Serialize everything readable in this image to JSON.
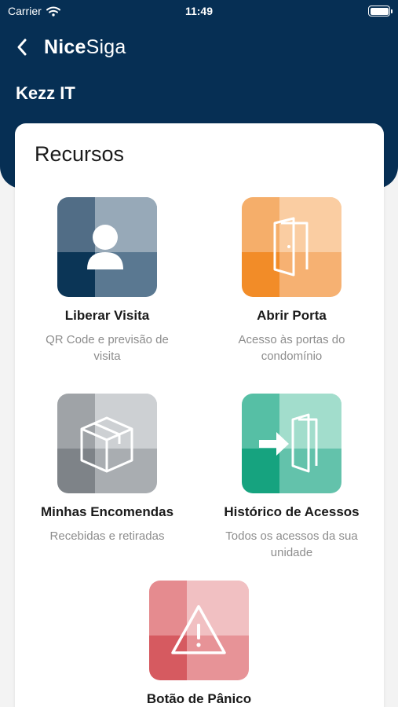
{
  "status_bar": {
    "carrier": "Carrier",
    "time": "11:49",
    "battery_level": 1.0
  },
  "nav": {
    "brand_bold": "Nice",
    "brand_regular": "Siga"
  },
  "company": "Kezz IT",
  "section_title": "Recursos",
  "features": [
    {
      "label": "Liberar Visita",
      "desc": "QR Code e previsão de visita",
      "icon": "user-icon",
      "colors": [
        "#516d86",
        "#97a9b8",
        "#0b3556",
        "#5a7891"
      ]
    },
    {
      "label": "Abrir Porta",
      "desc": "Acesso às portas do condomínio",
      "icon": "door-icon",
      "colors": [
        "#f5ae6a",
        "#facda2",
        "#f28c28",
        "#f6b172"
      ]
    },
    {
      "label": "Minhas Encomendas",
      "desc": "Recebidas e retiradas",
      "icon": "box-icon",
      "colors": [
        "#9fa3a7",
        "#cdd0d3",
        "#7e8388",
        "#a9adb1"
      ]
    },
    {
      "label": "Histórico de Acessos",
      "desc": "Todos os acessos da sua unidade",
      "icon": "door-enter-icon",
      "colors": [
        "#56bfa5",
        "#a2ddcc",
        "#16a37f",
        "#63c2ab"
      ]
    },
    {
      "label": "Botão de Pânico",
      "desc": "",
      "icon": "warning-icon",
      "colors": [
        "#e58b8f",
        "#f1c0c2",
        "#d65a60",
        "#e79397"
      ]
    }
  ]
}
